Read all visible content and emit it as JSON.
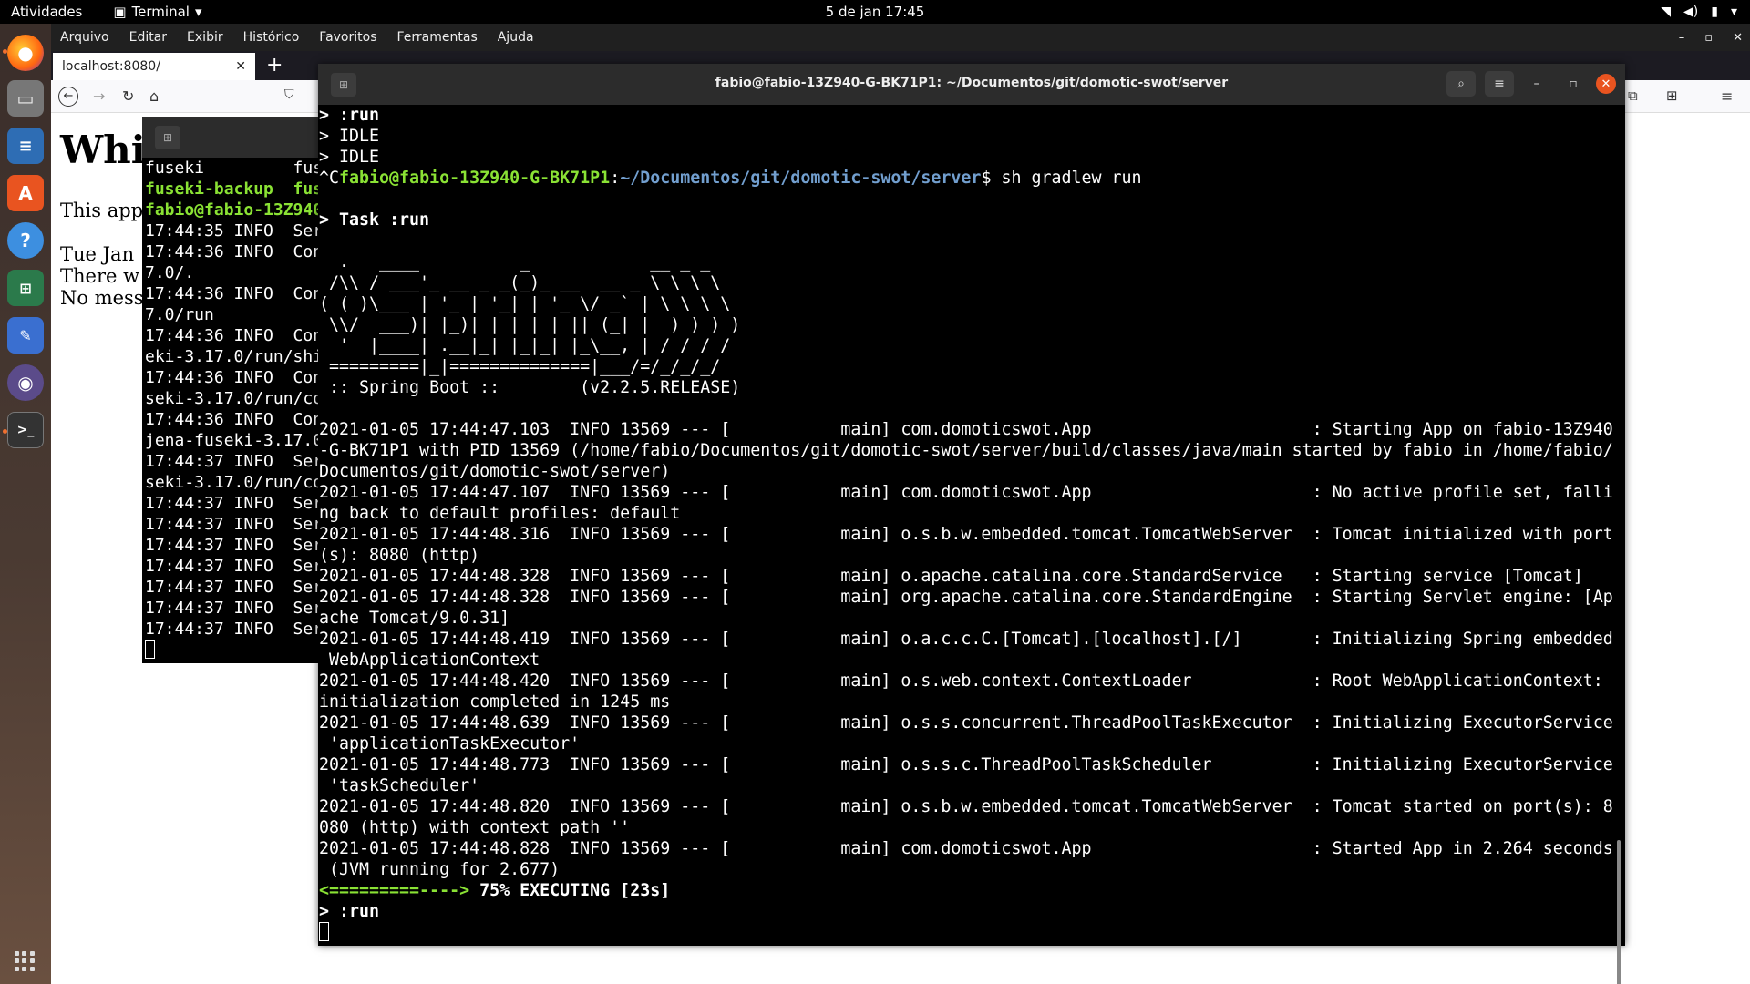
{
  "topbar": {
    "activities": "Atividades",
    "app_name": "Terminal",
    "clock": "5 de jan  17:45"
  },
  "dock": {
    "apps": [
      "firefox-icon",
      "files-icon",
      "writer-icon",
      "software-icon",
      "help-icon",
      "settings-icon",
      "editor-icon",
      "screenshot-icon",
      "terminal-icon"
    ]
  },
  "firefox": {
    "menu": [
      "Arquivo",
      "Editar",
      "Exibir",
      "Histórico",
      "Favoritos",
      "Ferramentas",
      "Ajuda"
    ],
    "tab_title": "localhost:8080/",
    "page": {
      "heading": "Whi",
      "p1": "This app",
      "p2": "Tue Jan",
      "p3": "There w",
      "p4": "No mess"
    }
  },
  "term_small": {
    "lines": [
      "fuseki         fus",
      "fuseki-backup  fus",
      "fabio@fabio-13Z940",
      "17:44:35 INFO  Ser",
      "17:44:36 INFO  Con",
      "7.0/.",
      "17:44:36 INFO  Con",
      "7.0/run",
      "17:44:36 INFO  Con",
      "eki-3.17.0/run/shi",
      "17:44:36 INFO  Con",
      "seki-3.17.0/run/co",
      "17:44:36 INFO  Con",
      "jena-fuseki-3.17.0",
      "17:44:37 INFO  Ser",
      "seki-3.17.0/run/co",
      "17:44:37 INFO  Ser",
      "17:44:37 INFO  Ser",
      "17:44:37 INFO  Ser",
      "17:44:37 INFO  Ser",
      "17:44:37 INFO  Ser",
      "17:44:37 INFO  Ser",
      "17:44:37 INFO  Ser"
    ]
  },
  "term_main": {
    "title": "fabio@fabio-13Z940-G-BK71P1: ~/Documentos/git/domotic-swot/server",
    "head": [
      "> :run",
      "> IDLE",
      "> IDLE"
    ],
    "prompt_prefix": "^C",
    "prompt_user": "fabio@fabio-13Z940-G-BK71P1",
    "prompt_path": "~/Documentos/git/domotic-swot/server",
    "prompt_cmd": "$ sh gradlew run",
    "task": "> Task :run",
    "banner": [
      "  .   ____          _            __ _ _",
      " /\\\\ / ___'_ __ _ _(_)_ __  __ _ \\ \\ \\ \\",
      "( ( )\\___ | '_ | '_| | '_ \\/ _` | \\ \\ \\ \\",
      " \\\\/  ___)| |_)| | | | | || (_| |  ) ) ) )",
      "  '  |____| .__|_| |_|_| |_\\__, | / / / /",
      " =========|_|==============|___/=/_/_/_/",
      " :: Spring Boot ::        (v2.2.5.RELEASE)"
    ],
    "log": [
      "2021-01-05 17:44:47.103  INFO 13569 --- [           main] com.domoticswot.App                      : Starting App on fabio-13Z940",
      "-G-BK71P1 with PID 13569 (/home/fabio/Documentos/git/domotic-swot/server/build/classes/java/main started by fabio in /home/fabio/",
      "Documentos/git/domotic-swot/server)",
      "2021-01-05 17:44:47.107  INFO 13569 --- [           main] com.domoticswot.App                      : No active profile set, falli",
      "ng back to default profiles: default",
      "2021-01-05 17:44:48.316  INFO 13569 --- [           main] o.s.b.w.embedded.tomcat.TomcatWebServer  : Tomcat initialized with port",
      "(s): 8080 (http)",
      "2021-01-05 17:44:48.328  INFO 13569 --- [           main] o.apache.catalina.core.StandardService   : Starting service [Tomcat]",
      "2021-01-05 17:44:48.328  INFO 13569 --- [           main] org.apache.catalina.core.StandardEngine  : Starting Servlet engine: [Ap",
      "ache Tomcat/9.0.31]",
      "2021-01-05 17:44:48.419  INFO 13569 --- [           main] o.a.c.c.C.[Tomcat].[localhost].[/]       : Initializing Spring embedded",
      " WebApplicationContext",
      "2021-01-05 17:44:48.420  INFO 13569 --- [           main] o.s.web.context.ContextLoader            : Root WebApplicationContext:",
      "initialization completed in 1245 ms",
      "2021-01-05 17:44:48.639  INFO 13569 --- [           main] o.s.s.concurrent.ThreadPoolTaskExecutor  : Initializing ExecutorService",
      " 'applicationTaskExecutor'",
      "2021-01-05 17:44:48.773  INFO 13569 --- [           main] o.s.s.c.ThreadPoolTaskScheduler          : Initializing ExecutorService",
      " 'taskScheduler'",
      "2021-01-05 17:44:48.820  INFO 13569 --- [           main] o.s.b.w.embedded.tomcat.TomcatWebServer  : Tomcat started on port(s): 8",
      "080 (http) with context path ''",
      "2021-01-05 17:44:48.828  INFO 13569 --- [           main] com.domoticswot.App                      : Started App in 2.264 seconds",
      " (JVM running for 2.677)"
    ],
    "progress_bar": "<=========---->",
    "progress_text": " 75% EXECUTING [23s]",
    "last": "> :run"
  },
  "colors": {
    "prompt_green": "#8ae234",
    "path_blue": "#729fcf",
    "close_orange": "#e95420"
  }
}
